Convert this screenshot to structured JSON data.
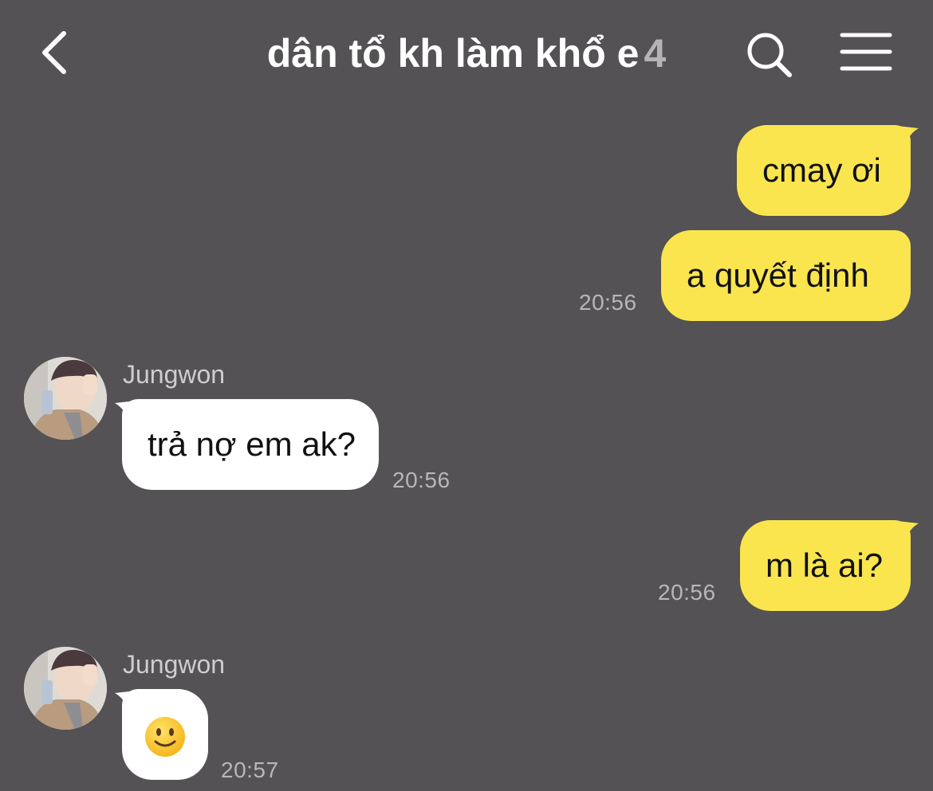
{
  "header": {
    "title": "dân tổ kh làm khổ e",
    "member_count": "4",
    "back_icon": "chevron-left-icon",
    "search_icon": "search-icon",
    "menu_icon": "hamburger-menu-icon"
  },
  "colors": {
    "background": "#545254",
    "sent_bubble": "#fae54f",
    "received_bubble": "#ffffff",
    "timestamp": "#b8b6b8"
  },
  "messages": [
    {
      "direction": "sent",
      "text": "cmay ơi",
      "time": ""
    },
    {
      "direction": "sent",
      "text": "a quyết định",
      "time": "20:56"
    },
    {
      "direction": "received",
      "sender": "Jungwon",
      "text": "trả nợ em ak?",
      "time": "20:56"
    },
    {
      "direction": "sent",
      "text": "m là ai?",
      "time": "20:56"
    },
    {
      "direction": "received",
      "sender": "Jungwon",
      "text": "",
      "emoji": "slightly-smiling-face",
      "time": "20:57"
    }
  ]
}
